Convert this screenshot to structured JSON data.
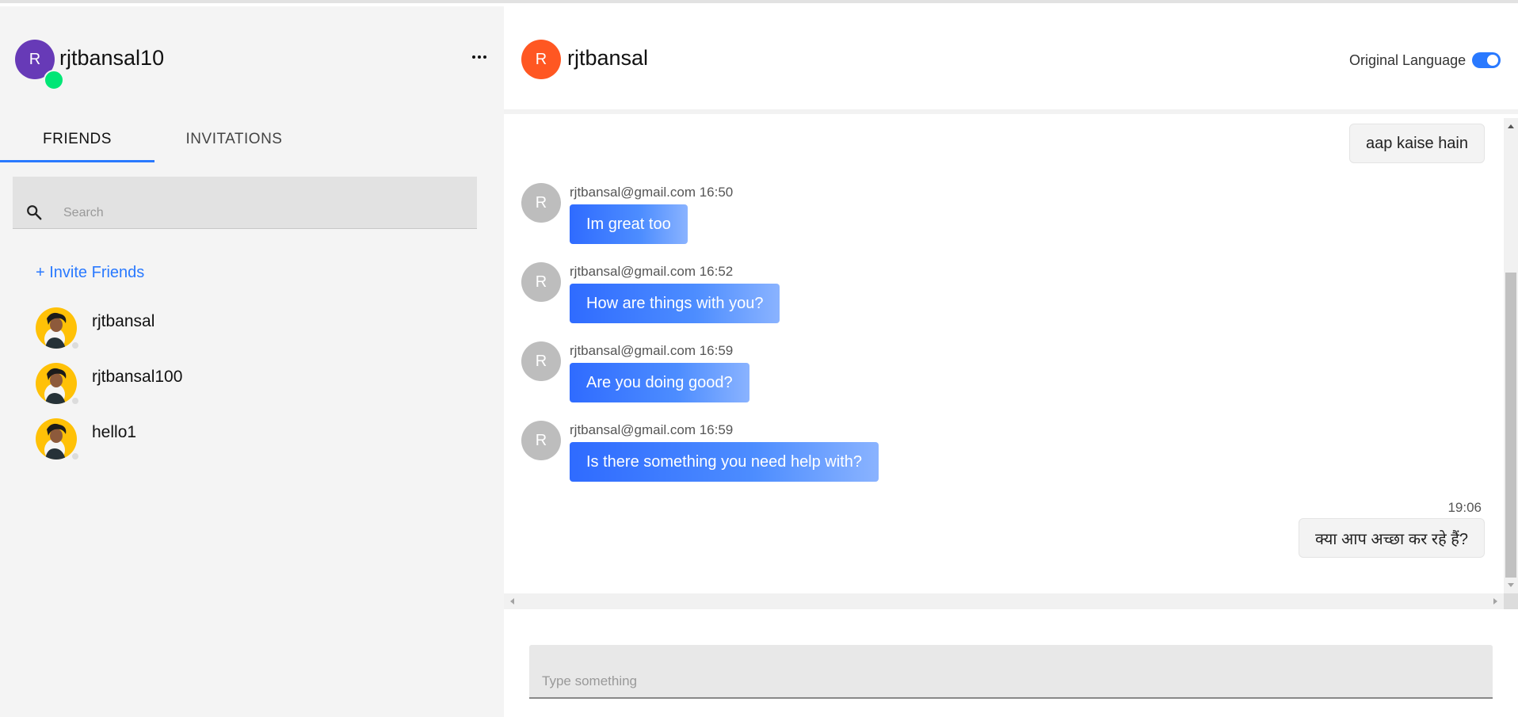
{
  "current_user": {
    "initial": "R",
    "username": "rjtbansal10",
    "status": "online",
    "avatar_color": "#673ab7",
    "status_color": "#00e676"
  },
  "sidebar": {
    "menu_icon": "more-horizontal-icon",
    "tabs": [
      {
        "label": "FRIENDS",
        "active": true
      },
      {
        "label": "INVITATIONS",
        "active": false
      }
    ],
    "search": {
      "placeholder": "Search",
      "value": "",
      "icon": "search-icon"
    },
    "invite_label": "+ Invite Friends",
    "friends": [
      {
        "name": "rjtbansal",
        "status": "offline"
      },
      {
        "name": "rjtbansal100",
        "status": "offline"
      },
      {
        "name": "hello1",
        "status": "offline"
      }
    ]
  },
  "chat": {
    "partner": {
      "initial": "R",
      "name": "rjtbansal",
      "avatar_color": "#ff5722"
    },
    "language_toggle": {
      "label": "Original Language",
      "on": true
    },
    "messages": [
      {
        "direction": "out",
        "text": "aap kaise hain"
      },
      {
        "direction": "in",
        "initial": "R",
        "meta": "rjtbansal@gmail.com 16:50",
        "text": "Im great too"
      },
      {
        "direction": "in",
        "initial": "R",
        "meta": "rjtbansal@gmail.com 16:52",
        "text": "How are things with you?"
      },
      {
        "direction": "in",
        "initial": "R",
        "meta": "rjtbansal@gmail.com 16:59",
        "text": "Are you doing good?"
      },
      {
        "direction": "in",
        "initial": "R",
        "meta": "rjtbansal@gmail.com 16:59",
        "text": "Is there something you need help with?"
      },
      {
        "direction": "out",
        "time": "19:06",
        "text": "क्या आप अच्छा कर रहे हैं?"
      }
    ],
    "composer": {
      "placeholder": "Type something",
      "value": ""
    }
  },
  "colors": {
    "accent": "#2979ff",
    "sidebar_bg": "#f4f4f4",
    "bubble_gradient_start": "#2f6bff",
    "bubble_gradient_end": "#8ab3ff"
  }
}
